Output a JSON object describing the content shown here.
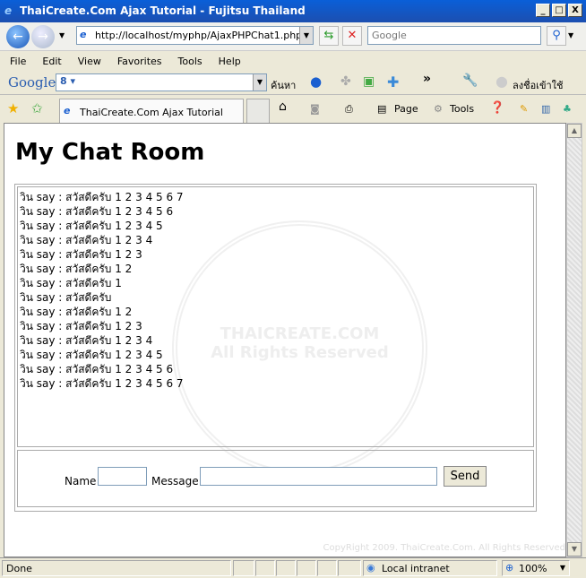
{
  "window": {
    "title": "ThaiCreate.Com Ajax Tutorial - Fujitsu Thailand",
    "minimize": "_",
    "maximize": "□",
    "close": "X"
  },
  "address": {
    "url": "http://localhost/myphp/AjaxPHPChat1.php",
    "search_placeholder": "Google"
  },
  "menu": [
    "File",
    "Edit",
    "View",
    "Favorites",
    "Tools",
    "Help"
  ],
  "google_bar": {
    "logo": "Google",
    "search_label": "ค้นหา",
    "signin": "ลงชื่อเข้าใช้"
  },
  "tab": {
    "title": "ThaiCreate.Com Ajax Tutorial"
  },
  "commands": {
    "page": "Page",
    "tools": "Tools"
  },
  "page": {
    "heading": "My Chat Room",
    "messages": [
      "วิน say : สวัสดีครับ 1 2 3 4 5 6 7",
      "วิน say : สวัสดีครับ 1 2 3 4 5 6",
      "วิน say : สวัสดีครับ 1 2 3 4 5",
      "วิน say : สวัสดีครับ 1 2 3 4",
      "วิน say : สวัสดีครับ 1 2 3",
      "วิน say : สวัสดีครับ 1 2",
      "วิน say : สวัสดีครับ 1",
      "วิน say : สวัสดีครับ",
      "วิน say : สวัสดีครับ 1 2",
      "วิน say : สวัสดีครับ 1 2 3",
      "วิน say : สวัสดีครับ 1 2 3 4",
      "วิน say : สวัสดีครับ 1 2 3 4 5",
      "วิน say : สวัสดีครับ 1 2 3 4 5 6",
      "วิน say : สวัสดีครับ 1 2 3 4 5 6 7"
    ],
    "name_label": "Name",
    "name_value": "",
    "message_label": "Message",
    "message_value": "",
    "send_label": "Send",
    "watermark": "THAICREATE.COM All Rights Reserved",
    "copyright": "CopyRight 2009. ThaiCreate.Com. All Rights Reserved"
  },
  "status": {
    "text": "Done",
    "zone": "Local intranet",
    "zoom": "100%"
  }
}
